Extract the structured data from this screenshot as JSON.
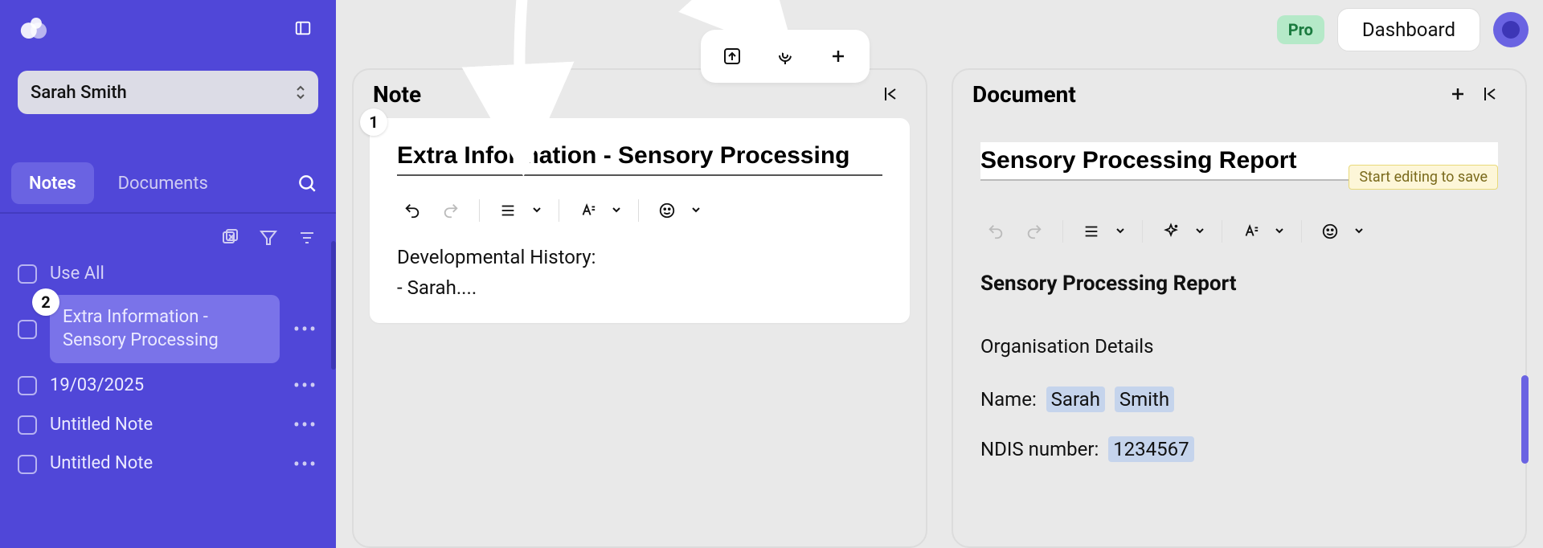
{
  "sidebar": {
    "client_name": "Sarah Smith",
    "tab_notes": "Notes",
    "tab_documents": "Documents",
    "use_all": "Use All",
    "items": [
      {
        "title": "Extra Information - Sensory Processing"
      },
      {
        "title": "19/03/2025"
      },
      {
        "title": "Untitled Note"
      },
      {
        "title": "Untitled Note"
      }
    ]
  },
  "topbar": {
    "pro": "Pro",
    "dashboard": "Dashboard"
  },
  "note_panel": {
    "header": "Note",
    "title": "Extra Information - Sensory Processing",
    "body_line1": "Developmental History:",
    "body_line2": "- Sarah...."
  },
  "doc_panel": {
    "header": "Document",
    "title": "Sensory Processing Report",
    "save_hint": "Start editing to save",
    "heading": "Sensory Processing Report",
    "section": "Organisation Details",
    "name_label": "Name:",
    "name_first": "Sarah",
    "name_last": "Smith",
    "ndis_label": "NDIS number:",
    "ndis_value": "1234567"
  },
  "badges": {
    "one": "1",
    "two": "2"
  }
}
